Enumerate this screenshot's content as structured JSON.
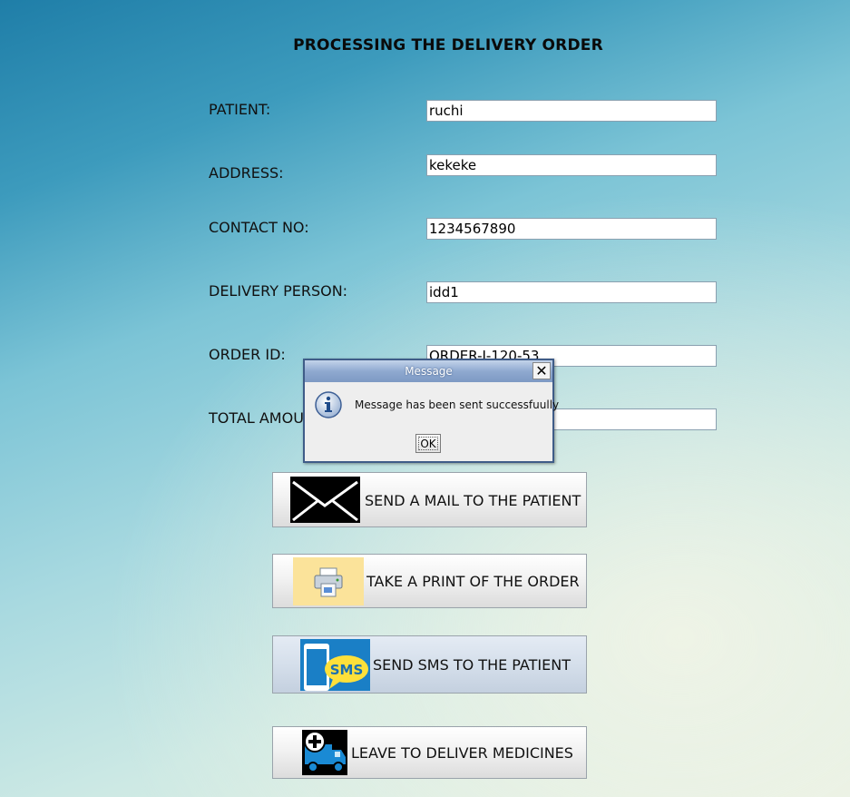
{
  "page": {
    "title": "PROCESSING THE DELIVERY ORDER"
  },
  "form": {
    "patient_label": "PATIENT:",
    "patient_value": "ruchi",
    "address_label": "ADDRESS:",
    "address_value": "kekeke",
    "contact_label": "CONTACT NO:",
    "contact_value": "1234567890",
    "delivery_person_label": "DELIVERY PERSON:",
    "delivery_person_value": "idd1",
    "order_id_label": "ORDER ID:",
    "order_id_value": "ORDER-I-120-53",
    "total_amount_label": "TOTAL AMOU",
    "total_amount_value": ""
  },
  "buttons": {
    "mail_label": "SEND A MAIL TO THE PATIENT",
    "print_label": "TAKE A PRINT OF THE ORDER",
    "sms_label": "SEND SMS TO THE PATIENT",
    "deliver_label": "LEAVE TO DELIVER MEDICINES",
    "sms_icon_text": "SMS"
  },
  "dialog": {
    "title": "Message",
    "message": "Message has been sent successfuully",
    "ok_label": "OK",
    "close_glyph": "✕"
  },
  "icons": {
    "mail": "envelope-icon",
    "print": "printer-icon",
    "sms": "sms-phone-icon",
    "deliver": "delivery-truck-icon",
    "dialog": "information-icon"
  }
}
